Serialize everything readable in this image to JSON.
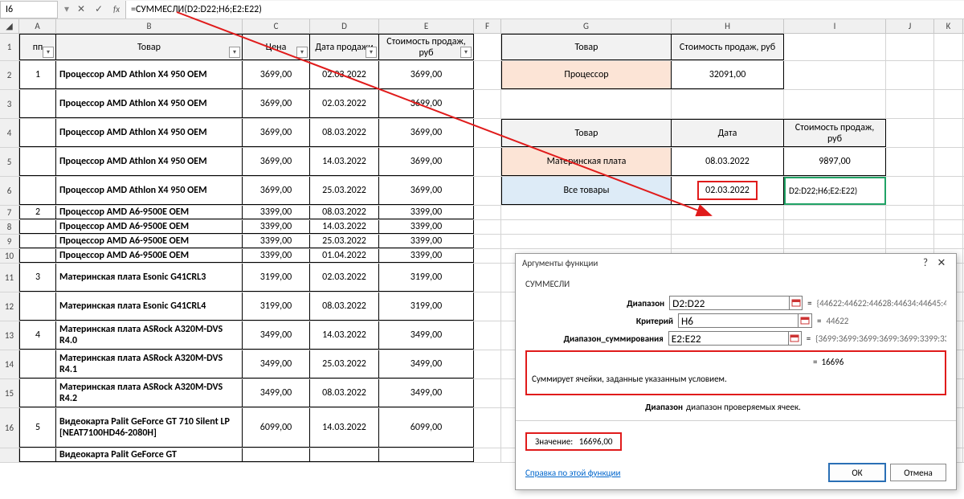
{
  "formula_bar": {
    "name_box": "I6",
    "formula": "=СУММЕСЛИ(D2:D22;H6;E2:E22)"
  },
  "columns": [
    "A",
    "B",
    "C",
    "D",
    "E",
    "F",
    "G",
    "H",
    "I",
    "J",
    "K"
  ],
  "headers_row1": {
    "A": "пп",
    "B": "Товар",
    "C": "Цена",
    "D": "Дата продажи",
    "E": "Стоимость продаж, руб",
    "G": "Товар",
    "H": "Стоимость продаж, руб"
  },
  "row2": {
    "A": "1",
    "B": "Процессор AMD Athlon X4 950 OEM",
    "C": "3699,00",
    "D": "02.03.2022",
    "E": "3699,00",
    "G": "Процессор",
    "H": "32091,00"
  },
  "row3": {
    "B": "Процессор AMD Athlon X4 950 OEM",
    "C": "3699,00",
    "D": "02.03.2022",
    "E": "3699,00"
  },
  "row4": {
    "B": "Процессор AMD Athlon X4 950 OEM",
    "C": "3699,00",
    "D": "08.03.2022",
    "E": "3699,00",
    "G": "Товар",
    "H": "Дата",
    "I": "Стоимость продаж, руб"
  },
  "row5": {
    "B": "Процессор AMD Athlon X4 950 OEM",
    "C": "3699,00",
    "D": "14.03.2022",
    "E": "3699,00",
    "G": "Материнская плата",
    "H": "08.03.2022",
    "I": "9897,00"
  },
  "row6": {
    "B": "Процессор AMD Athlon X4 950 OEM",
    "C": "3699,00",
    "D": "25.03.2022",
    "E": "3699,00",
    "G": "Все товары",
    "H": "02.03.2022",
    "I": "D2:D22;H6;E2:E22)"
  },
  "row7": {
    "A": "2",
    "B": "Процессор AMD A6-9500E OEM",
    "C": "3399,00",
    "D": "08.03.2022",
    "E": "3399,00"
  },
  "row8": {
    "B": "Процессор AMD A6-9500E OEM",
    "C": "3399,00",
    "D": "14.03.2022",
    "E": "3399,00"
  },
  "row9": {
    "B": "Процессор AMD A6-9500E OEM",
    "C": "3399,00",
    "D": "25.03.2022",
    "E": "3399,00"
  },
  "row10": {
    "B": "Процессор AMD A6-9500E OEM",
    "C": "3399,00",
    "D": "01.04.2022",
    "E": "3399,00"
  },
  "row11": {
    "A": "3",
    "B": "Материнская плата Esonic G41CRL3",
    "C": "3199,00",
    "D": "02.03.2022",
    "E": "3199,00"
  },
  "row12": {
    "B": "Материнская плата Esonic G41CRL4",
    "C": "3199,00",
    "D": "08.03.2022",
    "E": "3199,00"
  },
  "row13": {
    "A": "4",
    "B": "Материнская плата ASRock A320M-DVS R4.0",
    "C": "3499,00",
    "D": "14.03.2022",
    "E": "3499,00"
  },
  "row14": {
    "B": "Материнская плата ASRock A320M-DVS R4.1",
    "C": "3499,00",
    "D": "25.03.2022",
    "E": "3499,00"
  },
  "row15": {
    "B": "Материнская плата ASRock A320M-DVS R4.2",
    "C": "3499,00",
    "D": "08.03.2022",
    "E": "3499,00"
  },
  "row16": {
    "A": "5",
    "B": "Видеокарта Palit GeForce GT 710 Silent LP [NEAT7100HD46-2080H]",
    "C": "6099,00",
    "D": "14.03.2022",
    "E": "6099,00"
  },
  "row17": {
    "B": "Видеокарта Palit GeForce GT"
  },
  "dialog": {
    "title": "Аргументы функции",
    "func": "СУММЕСЛИ",
    "args": [
      {
        "label": "Диапазон",
        "value": "D2:D22",
        "result": "{44622:44622:44628:44634:44645:4..."
      },
      {
        "label": "Критерий",
        "value": "H6",
        "result": "44622"
      },
      {
        "label": "Диапазон_суммирования",
        "value": "E2:E22",
        "result": "{3699:3699:3699:3699:3699:3399:33..."
      }
    ],
    "interm_result": "16696",
    "desc": "Суммирует ячейки, заданные указанным условием.",
    "argdesc_label": "Диапазон",
    "argdesc_text": "диапазон проверяемых ячеек.",
    "value_label": "Значение:",
    "value": "16696,00",
    "help": "Справка по этой функции",
    "ok": "ОК",
    "cancel": "Отмена",
    "help_q": "?",
    "close": "✕"
  }
}
